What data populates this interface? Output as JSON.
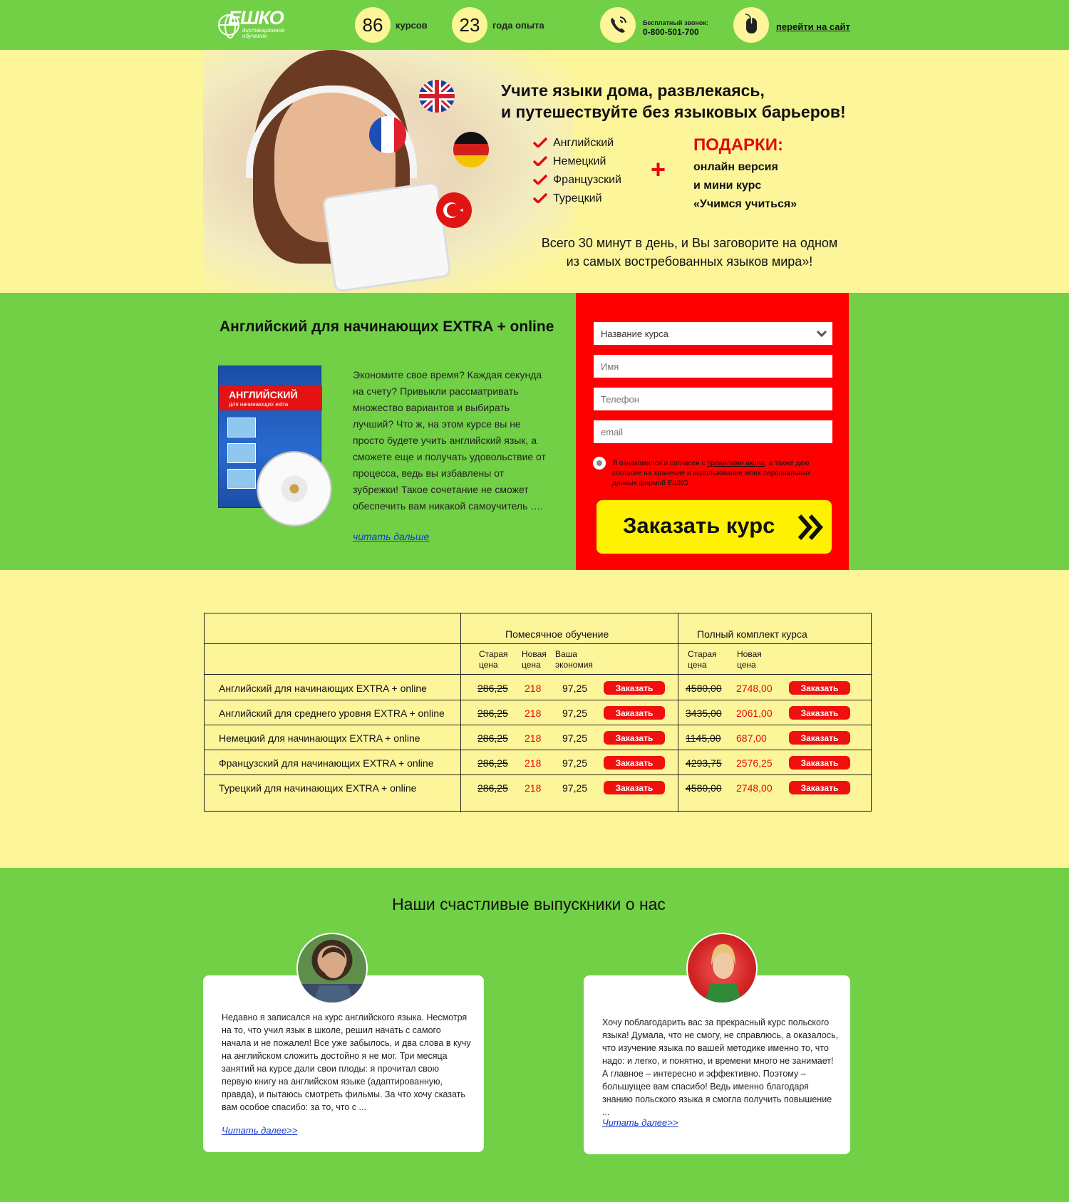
{
  "header": {
    "logo_text": "ЕШКО",
    "logo_subtitle": "дистанционное обучение",
    "stat_courses_value": "86",
    "stat_courses_label": "курсов",
    "stat_years_value": "23",
    "stat_years_label": "года опыта",
    "call_title": "Бесплатный звонок:",
    "call_phone": "0-800-501-700",
    "site_link": "перейти на сайт"
  },
  "hero": {
    "title_line1": "Учите языки дома, развлекаясь,",
    "title_line2": "и путешествуйте без языковых барьеров!",
    "languages": [
      "Английский",
      "Немецкий",
      "Французский",
      "Турецкий"
    ],
    "plus": "+",
    "gifts_title": "ПОДАРКИ:",
    "gifts_line1": "онлайн версия",
    "gifts_line2": "и мини курс",
    "gifts_line3": "«Учимся учиться»",
    "subtitle_line1": "Всего 30 минут в день, и Вы заговорите на одном",
    "subtitle_line2": "из самых востребованных языков мира»!"
  },
  "offer": {
    "title": "Английский для начинающих EXTRA + online",
    "book_title": "АНГЛИЙСКИЙ",
    "book_subtitle": "для начинающих extra",
    "description": "Экономите свое время? Каждая секунда на счету? Привыкли рассматривать множество вариантов и выбирать лучший? Что ж, на этом курсе вы не просто будете учить английский язык, а сможете еще и получать удовольствие от процесса, ведь вы избавлены от зубрежки! Такое сочетание не сможет обеспечить вам никакой самоучитель ….",
    "read_more": "читать дальше"
  },
  "form": {
    "course_select_value": "Название курса",
    "name_placeholder": "Имя",
    "phone_placeholder": "Телефон",
    "email_placeholder": "email",
    "consent_part1": "Я ознакомился и согласен с ",
    "consent_link": "правилами акции",
    "consent_part2": ", а также даю согласие на хранение и использование моих персональных данных фирмой ЕШКО",
    "submit_label": "Заказать курс"
  },
  "pricing": {
    "group_monthly": "Помесячное обучение",
    "group_full": "Полный комплект курса",
    "col_old_1": "Старая",
    "col_old_2": "цена",
    "col_new_1": "Новая",
    "col_new_2": "цена",
    "col_save_1": "Ваша",
    "col_save_2": "экономия",
    "button_label": "Заказать",
    "rows": [
      {
        "course": "Английский для начинающих EXTRA + online",
        "m_old": "286,25",
        "m_new": "218",
        "m_save": "97,25",
        "f_old": "4580,00",
        "f_new": "2748,00"
      },
      {
        "course": "Английский для среднего уровня EXTRA + online",
        "m_old": "286,25",
        "m_new": "218",
        "m_save": "97,25",
        "f_old": "3435,00",
        "f_new": "2061,00"
      },
      {
        "course": "Немецкий для начинающих EXTRA + online",
        "m_old": "286,25",
        "m_new": "218",
        "m_save": "97,25",
        "f_old": "1145,00",
        "f_new": "687,00"
      },
      {
        "course": "Французский для начинающих EXTRA + online",
        "m_old": "286,25",
        "m_new": "218",
        "m_save": "97,25",
        "f_old": "4293,75",
        "f_new": "2576,25"
      },
      {
        "course": "Турецкий для начинающих EXTRA + online",
        "m_old": "286,25",
        "m_new": "218",
        "m_save": "97,25",
        "f_old": "4580,00",
        "f_new": "2748,00"
      }
    ]
  },
  "reviews": {
    "title": "Наши счастливые выпускники о нас",
    "items": [
      {
        "text": "Недавно я записался на курс английского языка. Несмотря на то, что учил язык в школе, решил начать с самого начала и не пожалел! Все уже забылось, и два слова в кучу на английском сложить достойно я не мог. Три месяца занятий на курсе дали свои плоды: я прочитал свою первую книгу на английском языке (адаптированную, правда), и пытаюсь смотреть фильмы. За что хочу сказать вам особое спасибо: за то, что с ...",
        "link": "Читать далее>>"
      },
      {
        "text": "Хочу поблагодарить вас за прекрасный курс польского языка! Думала, что не смогу, не справлюсь, а оказалось, что изучение языка по вашей методике именно то, что надо: и легко, и понятно, и времени много не занимает! А главное – интересно и эффективно. Поэтому – большущее вам спасибо! Ведь именно благодаря знанию польского языка я смогла получить повышение ...",
        "link": "Читать далее>>"
      }
    ]
  },
  "colors": {
    "green": "#72d046",
    "cream": "#fdf59a",
    "red": "#ff0000",
    "yellow_button": "#fff200"
  }
}
